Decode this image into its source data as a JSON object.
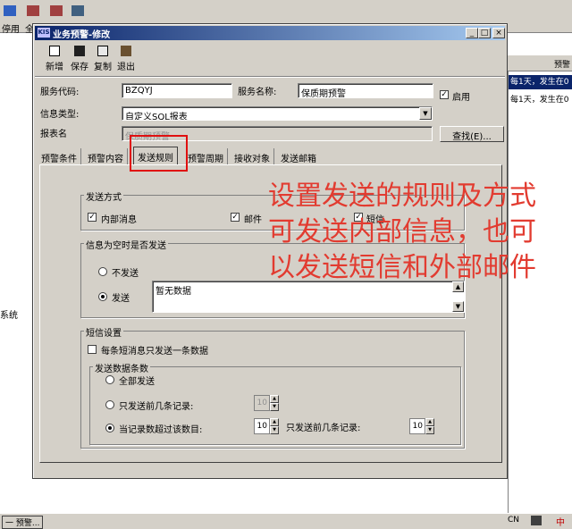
{
  "background": {
    "toolbar_label_left": "停用",
    "toolbar_label_right": "全",
    "right_header": "预警",
    "right_rows": [
      "每1天，发生在0",
      "每1天，发生在0"
    ],
    "left_text": "系统",
    "taskbar_left": "一 预警...",
    "taskbar_ime": "CN",
    "taskbar_icons": [
      "中"
    ]
  },
  "dialog": {
    "app_icon": "KIS",
    "title": "业务预警-修改",
    "window_buttons": [
      "_",
      "□",
      "×"
    ],
    "toolbar": [
      {
        "label": "新增",
        "icon": "new-document-icon"
      },
      {
        "label": "保存",
        "icon": "save-disk-icon"
      },
      {
        "label": "复制",
        "icon": "copy-icon"
      },
      {
        "label": "退出",
        "icon": "exit-door-icon"
      }
    ],
    "form": {
      "service_code_label": "服务代码:",
      "service_code_value": "BZQYJ",
      "service_name_label": "服务名称:",
      "service_name_value": "保质期预警",
      "enable_label": "启用",
      "info_type_label": "信息类型:",
      "info_type_value": "自定义SQL报表",
      "report_name_label": "报表名",
      "report_name_value": "保质期预警",
      "search_button": "查找(E)..."
    },
    "tabs": [
      "预警条件",
      "预警内容",
      "发送规则",
      "预警周期",
      "接收对象",
      "发送邮箱"
    ],
    "active_tab": 2,
    "send_method": {
      "title": "发送方式",
      "internal": "内部消息",
      "email": "邮件",
      "sms": "短信"
    },
    "empty_send": {
      "title": "信息为空时是否发送",
      "no_send": "不发送",
      "send": "发送",
      "text_value": "暂无数据"
    },
    "sms_settings": {
      "title": "短信设置",
      "one_per_msg": "每条短消息只发送一条数据",
      "count_group_title": "发送数据条数",
      "all": "全部发送",
      "first_n": "只发送前几条记录:",
      "first_n_value": "10",
      "over_threshold": "当记录数超过该数目:",
      "over_threshold_value": "10",
      "then_first_n": "只发送前几条记录:",
      "then_first_n_value": "10"
    }
  },
  "annotation": {
    "lines": [
      "设置发送的规则及方式",
      "可发送内部信息，也可",
      "以发送短信和外部邮件"
    ],
    "color": "#e23b30"
  }
}
